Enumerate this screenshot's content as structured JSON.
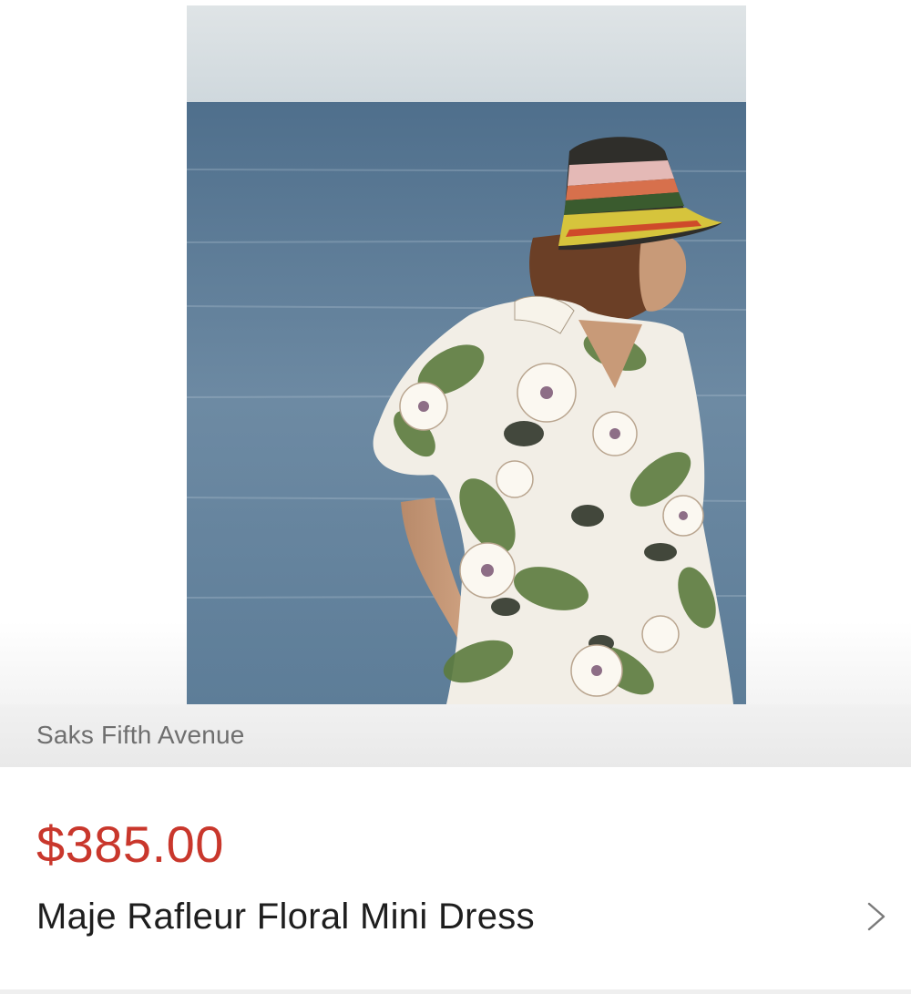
{
  "product": {
    "retailer": "Saks Fifth Avenue",
    "price": "$385.00",
    "title": "Maje Rafleur Floral Mini Dress",
    "image_alt": "Model wearing floral dress and striped crochet bucket hat by the sea",
    "chevron_icon": "chevron-right-icon"
  },
  "colors": {
    "price": "#c9372c",
    "retailer_text": "#6f6f6f",
    "title_text": "#1e1e1e"
  }
}
